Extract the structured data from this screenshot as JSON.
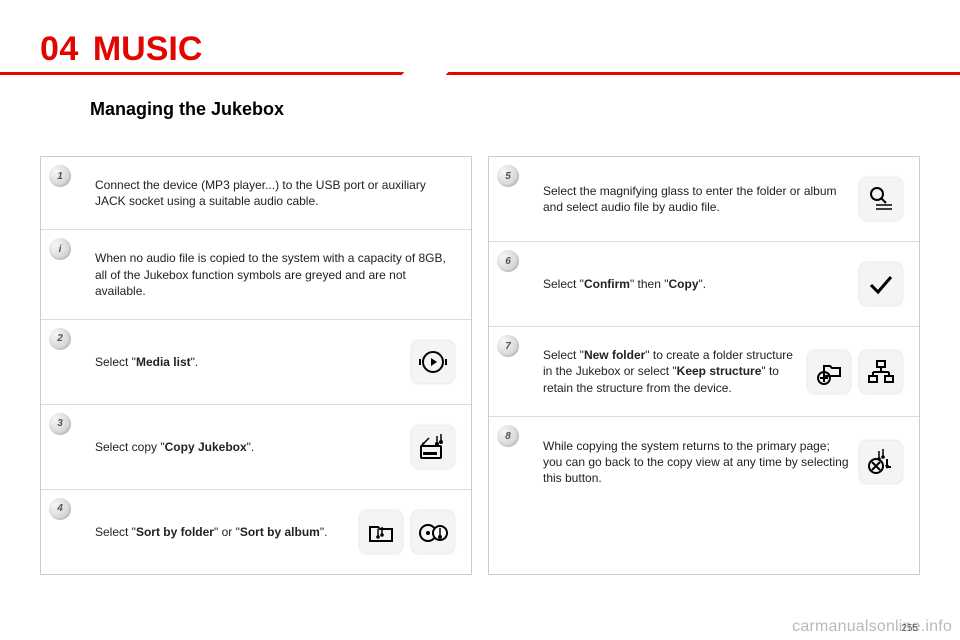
{
  "header": {
    "chapter_number": "04",
    "chapter_title": "MUSIC",
    "section_title": "Managing the Jukebox"
  },
  "left_steps": [
    {
      "num": "1",
      "num_label": "1",
      "text": "Connect the device (MP3 player...) to the USB port or auxiliary JACK socket using a suitable audio cable."
    },
    {
      "num": "i",
      "num_label": "i",
      "text": "When no audio file is copied to the system with a capacity of 8GB, all of the Jukebox function symbols are greyed and are not available."
    },
    {
      "num": "2",
      "num_label": "2",
      "text_pre": "Select \"",
      "bold1": "Media list",
      "text_post": "\".",
      "icon": "media-list-icon"
    },
    {
      "num": "3",
      "num_label": "3",
      "text_pre": "Select copy \"",
      "bold1": "Copy Jukebox",
      "text_post": "\".",
      "icon": "copy-jukebox-icon"
    },
    {
      "num": "4",
      "num_label": "4",
      "text_pre": "Select \"",
      "bold1": "Sort by folder",
      "text_mid": "\" or \"",
      "bold2": "Sort by album",
      "text_post": "\".",
      "icon": "sort-folder-icon",
      "icon2": "sort-album-icon"
    }
  ],
  "right_steps": [
    {
      "num": "5",
      "num_label": "5",
      "text": "Select the magnifying glass to enter the folder or album and select audio file by audio file.",
      "icon": "magnify-list-icon"
    },
    {
      "num": "6",
      "num_label": "6",
      "text_pre": "Select \"",
      "bold1": "Confirm",
      "text_mid": "\" then \"",
      "bold2": "Copy",
      "text_post": "\".",
      "icon": "check-icon"
    },
    {
      "num": "7",
      "num_label": "7",
      "text_pre": "Select \"",
      "bold1": "New folder",
      "text_mid": "\" to create a folder structure in the Jukebox or select \"",
      "bold2": "Keep structure",
      "text_post": "\" to retain the structure from the device.",
      "icon": "new-folder-icon",
      "icon2": "keep-structure-icon"
    },
    {
      "num": "8",
      "num_label": "8",
      "text": "While copying the system returns to the primary page; you can go back to the copy view at any time by selecting this button.",
      "icon": "copy-progress-icon"
    }
  ],
  "footer": {
    "watermark": "carmanualsonline.info",
    "page_number": "255"
  }
}
